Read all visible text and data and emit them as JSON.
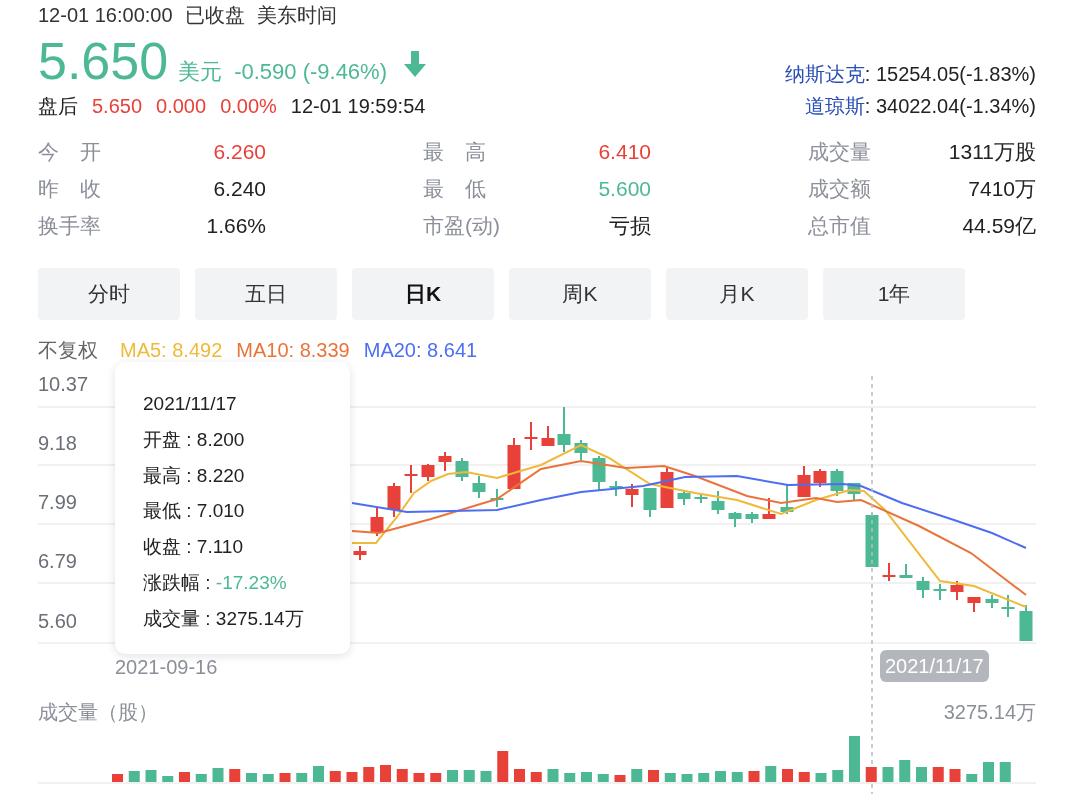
{
  "status": {
    "time": "12-01 16:00:00",
    "state": "已收盘",
    "zone": "美东时间"
  },
  "quote": {
    "price": "5.650",
    "currency": "美元",
    "change": "-0.590 (-9.46%)",
    "color": "#4cb994"
  },
  "indices": [
    {
      "name": "纳斯达克",
      "value": ": 15254.05(-1.83%)"
    },
    {
      "name": "道琼斯",
      "value": ": 34022.04(-1.34%)"
    }
  ],
  "after_hours": {
    "label": "盘后",
    "values": [
      "5.650",
      "0.000",
      "0.00%"
    ],
    "color": "#e8413a",
    "time": "12-01 19:59:54"
  },
  "stats": [
    {
      "label": "今　开",
      "value": "6.260",
      "color": "#e8413a"
    },
    {
      "label": "最　高",
      "value": "6.410",
      "color": "#e8413a"
    },
    {
      "label": "成交量",
      "value": "1311万股",
      "color": "#222222"
    },
    {
      "label": "昨　收",
      "value": "6.240",
      "color": "#222222"
    },
    {
      "label": "最　低",
      "value": "5.600",
      "color": "#4cb994"
    },
    {
      "label": "成交额",
      "value": "7410万",
      "color": "#222222"
    },
    {
      "label": "换手率",
      "value": "1.66%",
      "color": "#222222"
    },
    {
      "label": "市盈(动)",
      "value": "亏损",
      "color": "#222222"
    },
    {
      "label": "总市值",
      "value": "44.59亿",
      "color": "#222222"
    }
  ],
  "tabs": [
    {
      "label": "分时",
      "selected": false
    },
    {
      "label": "五日",
      "selected": false
    },
    {
      "label": "日K",
      "selected": true
    },
    {
      "label": "周K",
      "selected": false
    },
    {
      "label": "月K",
      "selected": false
    },
    {
      "label": "1年",
      "selected": false
    }
  ],
  "adjustment": "不复权",
  "moving_averages": [
    {
      "label": "MA5: 8.492",
      "color": "#f0b93a"
    },
    {
      "label": "MA10: 8.339",
      "color": "#e9743b"
    },
    {
      "label": "MA20: 8.641",
      "color": "#4e6ef2"
    }
  ],
  "chart": {
    "y_labels": [
      "10.37",
      "9.18",
      "7.99",
      "6.79",
      "5.60"
    ],
    "x_label": "2021-09-16",
    "crosshair_label": "2021/11/17",
    "volume_title": "成交量（股）",
    "volume_value": "3275.14万"
  },
  "tooltip": {
    "date": "2021/11/17",
    "rows": [
      {
        "label": "开盘 : ",
        "value": "8.200",
        "color": "#222222"
      },
      {
        "label": "最高 : ",
        "value": "8.220",
        "color": "#222222"
      },
      {
        "label": "最低 : ",
        "value": "7.010",
        "color": "#222222"
      },
      {
        "label": "收盘 : ",
        "value": "7.110",
        "color": "#222222"
      },
      {
        "label": "涨跌幅 : ",
        "value": "-17.23%",
        "color": "#4cb994"
      },
      {
        "label": "成交量 : ",
        "value": "3275.14万",
        "color": "#222222"
      }
    ]
  }
}
